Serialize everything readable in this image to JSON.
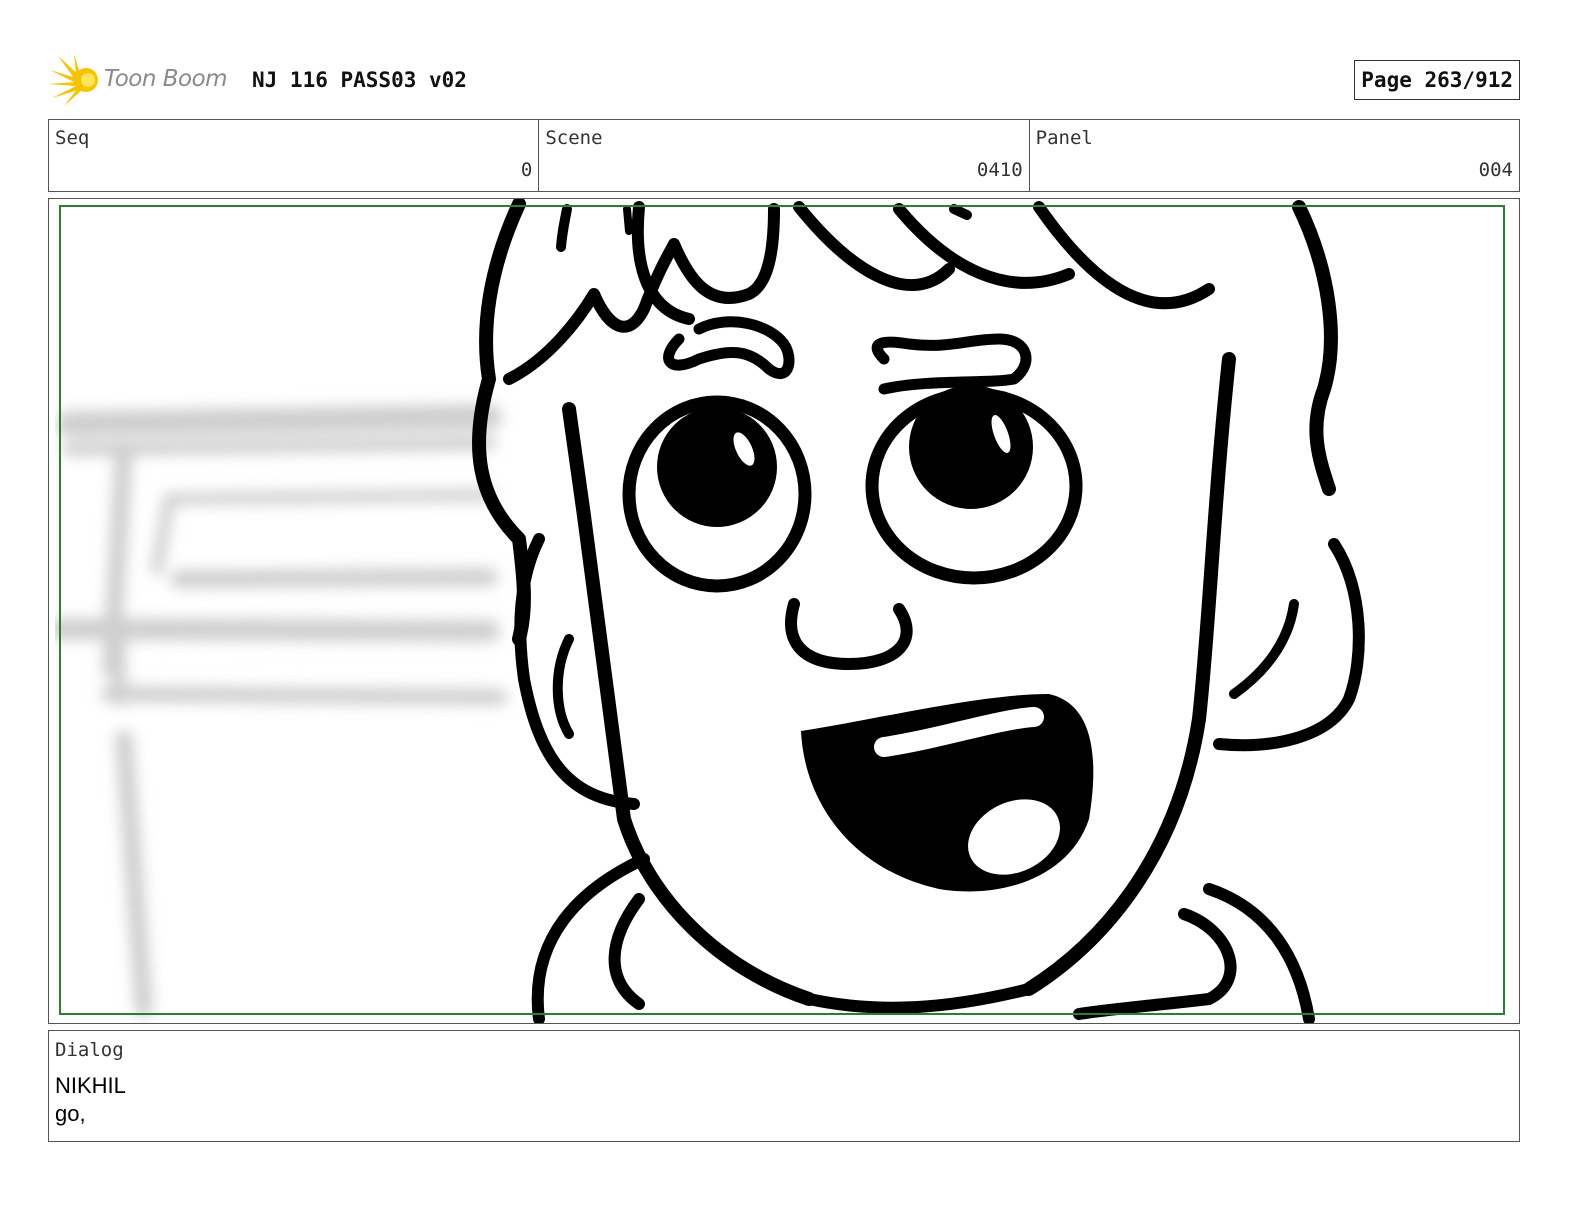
{
  "header": {
    "logo_text": "Toon Boom",
    "title": "NJ 116 PASS03 v02",
    "page": "Page 263/912"
  },
  "info": {
    "seq_label": "Seq",
    "seq_value": "0",
    "scene_label": "Scene",
    "scene_value": "0410",
    "panel_label": "Panel",
    "panel_value": "004"
  },
  "dialog": {
    "label": "Dialog",
    "speaker": "NIKHIL",
    "line": "go,"
  },
  "colors": {
    "safe_frame": "#2e7d32",
    "logo_yellow": "#f5c400",
    "ink": "#000000"
  }
}
